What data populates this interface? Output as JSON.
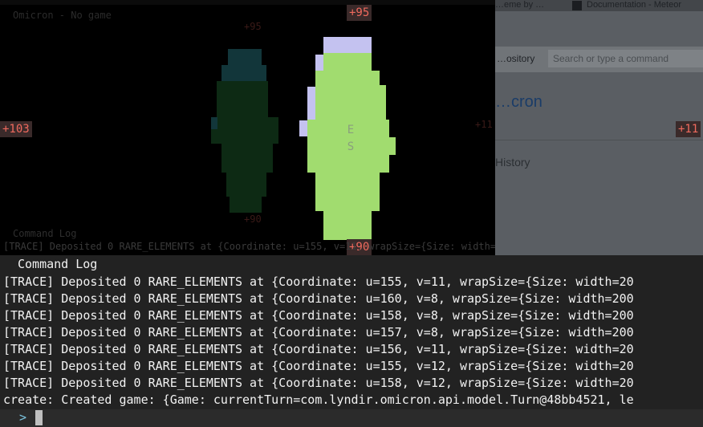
{
  "background_window": {
    "tabs": [
      "…eme by …",
      "Documentation - Meteor"
    ],
    "repo_select": "…ository",
    "search_placeholder": "Search or type a command",
    "heading": "…cron",
    "history_link": "History"
  },
  "game": {
    "window_title": "Omicron - No game",
    "edge_labels": {
      "top": "+95",
      "bottom": "+90",
      "left": "+103",
      "right": "+11"
    },
    "faint_labels": {
      "top": "+95",
      "bottom": "+90",
      "right": "+11"
    },
    "unit_labels": [
      "E",
      "S"
    ],
    "colors": {
      "player_territory": "#a1dc6f",
      "player_border": "#c4c2f0",
      "rival_territory": "#0d2a14",
      "rival_border": "#12363a",
      "edge_label_text": "#f06a5e"
    }
  },
  "command_log": {
    "title": "Command Log",
    "lines": [
      "[TRACE] Deposited 0 RARE_ELEMENTS at {Coordinate: u=155, v=11, wrapSize={Size: width=20",
      "[TRACE] Deposited 0 RARE_ELEMENTS at {Coordinate: u=160, v=8, wrapSize={Size: width=200",
      "[TRACE] Deposited 0 RARE_ELEMENTS at {Coordinate: u=158, v=8, wrapSize={Size: width=200",
      "[TRACE] Deposited 0 RARE_ELEMENTS at {Coordinate: u=157, v=8, wrapSize={Size: width=200",
      "[TRACE] Deposited 0 RARE_ELEMENTS at {Coordinate: u=156, v=11, wrapSize={Size: width=20",
      "[TRACE] Deposited 0 RARE_ELEMENTS at {Coordinate: u=155, v=12, wrapSize={Size: width=20",
      "[TRACE] Deposited 0 RARE_ELEMENTS at {Coordinate: u=158, v=12, wrapSize={Size: width=20",
      "create: Created game: {Game: currentTurn=com.lyndir.omicron.api.model.Turn@48bb4521, le"
    ],
    "ghost_lines": [
      "[TRACE] Deposited 0 RARE_ELEMENTS at {Coordinate: u=155, v=11, wrapSize={Size: width=20",
      "[TRACE] Deposited 0 RARE_ELEMENTS at {Coordinate: u=160, v=8, wrapSize={Size: width=200"
    ],
    "prompt": ">"
  }
}
